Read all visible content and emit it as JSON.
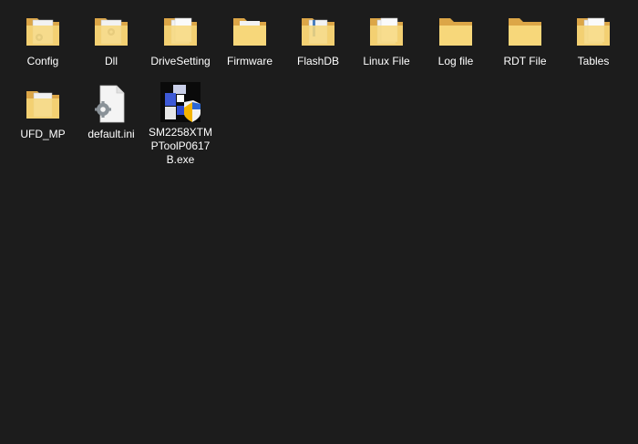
{
  "window": {
    "view": "large-icons",
    "background": "#1c1c1c"
  },
  "files": [
    {
      "label": "Config",
      "type": "folder",
      "icon": "folder-with-gear-icon"
    },
    {
      "label": "Dll",
      "type": "folder",
      "icon": "folder-with-gear-icon"
    },
    {
      "label": "DriveSetting",
      "type": "folder",
      "icon": "folder-with-documents-icon"
    },
    {
      "label": "Firmware",
      "type": "folder",
      "icon": "folder-icon"
    },
    {
      "label": "FlashDB",
      "type": "folder",
      "icon": "folder-with-documents-icon"
    },
    {
      "label": "Linux File",
      "type": "folder",
      "icon": "folder-with-documents-icon"
    },
    {
      "label": "Log file",
      "type": "folder",
      "icon": "folder-icon"
    },
    {
      "label": "RDT File",
      "type": "folder",
      "icon": "folder-icon"
    },
    {
      "label": "Tables",
      "type": "folder",
      "icon": "folder-with-documents-icon"
    },
    {
      "label": "UFD_MP",
      "type": "folder",
      "icon": "folder-with-documents-icon"
    },
    {
      "label": "default.ini",
      "type": "ini-file",
      "icon": "settings-file-icon"
    },
    {
      "label": "SM2258XTMPToolP0617B.exe",
      "type": "executable",
      "icon": "application-icon"
    }
  ],
  "colors": {
    "folder_back": "#dca647",
    "folder_front": "#f7d77a",
    "text": "#ffffff"
  }
}
